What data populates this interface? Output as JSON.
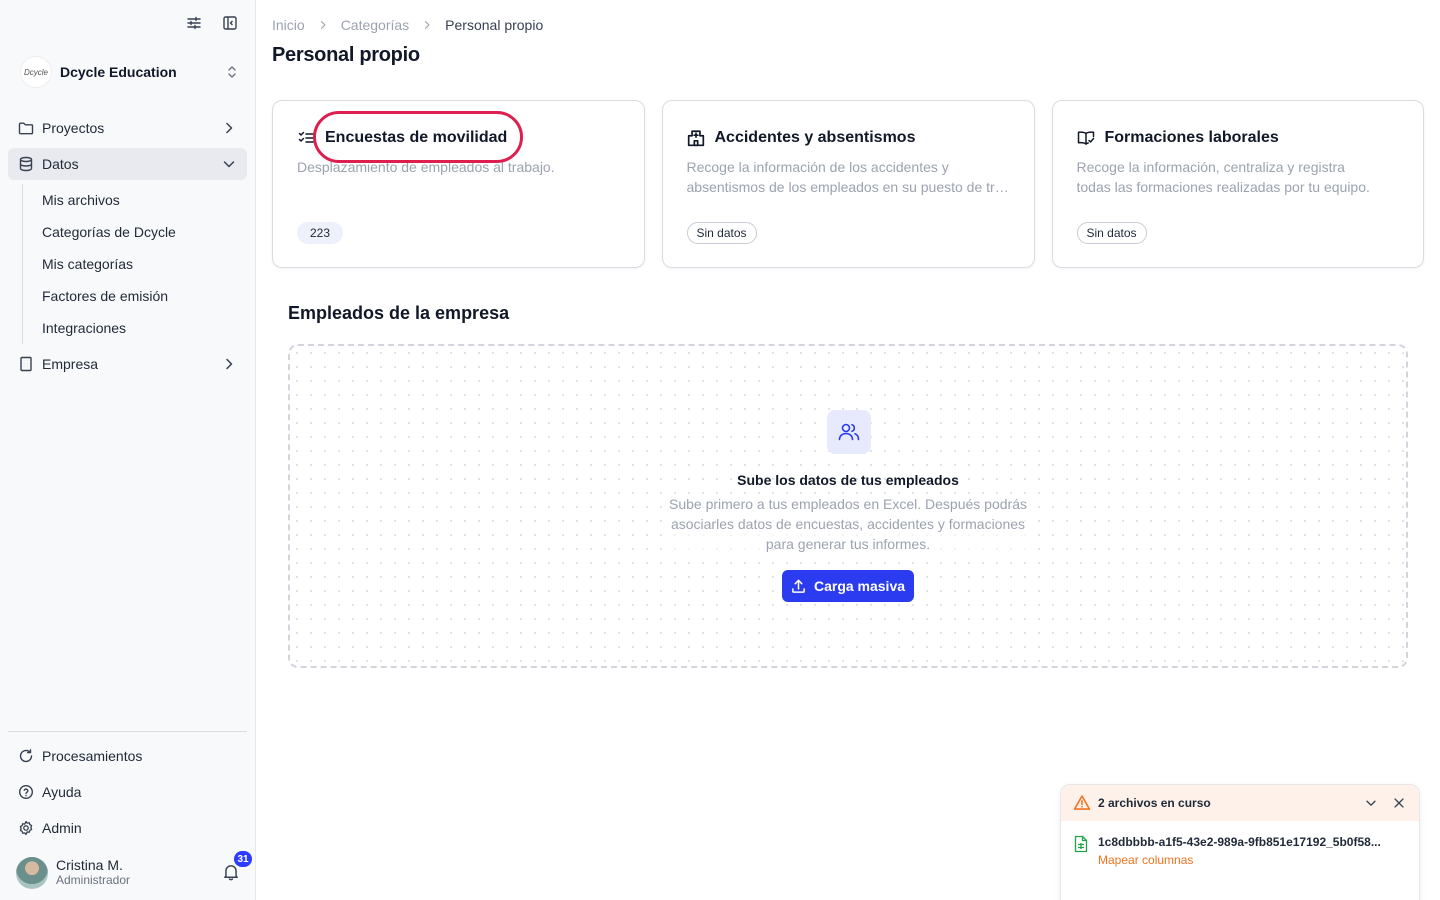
{
  "sidebar": {
    "org_logo_text": "Dcycle",
    "org_name": "Dcycle Education",
    "nav": {
      "proyectos": "Proyectos",
      "datos": "Datos",
      "empresa": "Empresa"
    },
    "datos_sub": {
      "mis_archivos": "Mis archivos",
      "categorias_dcycle": "Categorías de Dcycle",
      "mis_categorias": "Mis categorías",
      "factores": "Factores de emisión",
      "integraciones": "Integraciones"
    },
    "bottom": {
      "procesamientos": "Procesamientos",
      "ayuda": "Ayuda",
      "admin": "Admin"
    },
    "user": {
      "name": "Cristina M.",
      "role": "Administrador",
      "notifications": "31"
    }
  },
  "breadcrumb": {
    "home": "Inicio",
    "categories": "Categorías",
    "current": "Personal propio"
  },
  "page_title": "Personal propio",
  "cards": {
    "movilidad": {
      "title": "Encuestas de movilidad",
      "desc1": "Desplazamiento de empleados al trabajo.",
      "badge": "223"
    },
    "accidentes": {
      "title": "Accidentes y absentismos",
      "desc1": "Recoge la información de los accidentes y",
      "desc2": "absentismos de los empleados en su puesto de trabajo.",
      "badge": "Sin datos"
    },
    "formaciones": {
      "title": "Formaciones laborales",
      "desc1": "Recoge la información, centraliza y registra",
      "desc2": "todas las formaciones realizadas por tu equipo.",
      "badge": "Sin datos"
    }
  },
  "empleados": {
    "section_title": "Empleados de la empresa",
    "dz_title": "Sube los datos de tus empleados",
    "dz_text": "Sube primero a tus empleados en Excel. Después podrás asociarles datos de encuestas, accidentes y formaciones para generar tus informes.",
    "button": "Carga masiva"
  },
  "upload": {
    "title": "2 archivos en curso",
    "file_name": "1c8dbbbb-a1f5-43e2-989a-9fb851e17192_5b0f58...",
    "action": "Mapear columnas"
  },
  "colors": {
    "accent": "#2b3bf0",
    "highlight": "#dc1f4e",
    "warning": "#f0731f"
  }
}
